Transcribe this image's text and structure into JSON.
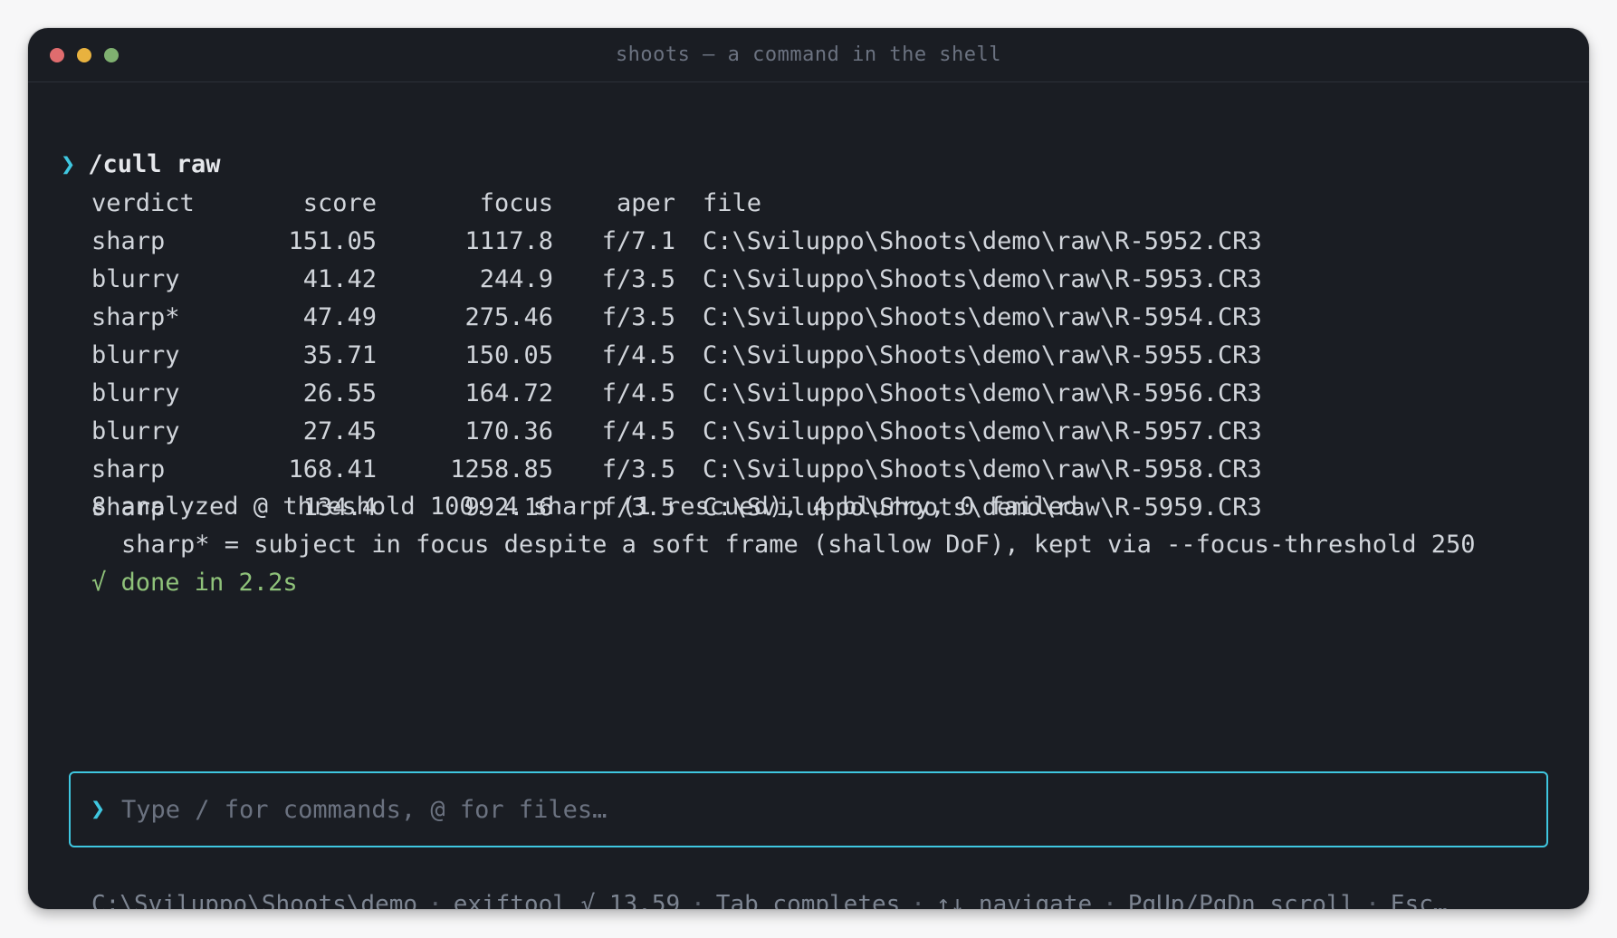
{
  "window": {
    "title": "shoots — a command in the shell"
  },
  "command": {
    "prompt": "❯",
    "text": "/cull raw"
  },
  "table": {
    "headers": {
      "verdict": "verdict",
      "score": "score",
      "focus": "focus",
      "aper": "aper",
      "file": "file"
    },
    "rows": [
      {
        "verdict": "sharp",
        "score": "151.05",
        "focus": "1117.8",
        "aper": "f/7.1",
        "file": "C:\\Sviluppo\\Shoots\\demo\\raw\\R-5952.CR3"
      },
      {
        "verdict": "blurry",
        "score": "41.42",
        "focus": "244.9",
        "aper": "f/3.5",
        "file": "C:\\Sviluppo\\Shoots\\demo\\raw\\R-5953.CR3"
      },
      {
        "verdict": "sharp*",
        "score": "47.49",
        "focus": "275.46",
        "aper": "f/3.5",
        "file": "C:\\Sviluppo\\Shoots\\demo\\raw\\R-5954.CR3"
      },
      {
        "verdict": "blurry",
        "score": "35.71",
        "focus": "150.05",
        "aper": "f/4.5",
        "file": "C:\\Sviluppo\\Shoots\\demo\\raw\\R-5955.CR3"
      },
      {
        "verdict": "blurry",
        "score": "26.55",
        "focus": "164.72",
        "aper": "f/4.5",
        "file": "C:\\Sviluppo\\Shoots\\demo\\raw\\R-5956.CR3"
      },
      {
        "verdict": "blurry",
        "score": "27.45",
        "focus": "170.36",
        "aper": "f/4.5",
        "file": "C:\\Sviluppo\\Shoots\\demo\\raw\\R-5957.CR3"
      },
      {
        "verdict": "sharp",
        "score": "168.41",
        "focus": "1258.85",
        "aper": "f/3.5",
        "file": "C:\\Sviluppo\\Shoots\\demo\\raw\\R-5958.CR3"
      },
      {
        "verdict": "sharp",
        "score": "134.4",
        "focus": "992.16",
        "aper": "f/3.5",
        "file": "C:\\Sviluppo\\Shoots\\demo\\raw\\R-5959.CR3"
      }
    ]
  },
  "summary": "8 analyzed @ threshold 100: 4 sharp (1 rescued), 4 blurry, 0 failed",
  "note": "sharp* = subject in focus despite a soft frame (shallow DoF), kept via --focus-threshold 250",
  "done": "√ done in 2.2s",
  "input": {
    "prompt": "❯",
    "placeholder": "Type / for commands, @ for files…",
    "value": ""
  },
  "statusbar": {
    "separator": "·",
    "items": [
      "C:\\Sviluppo\\Shoots\\demo",
      "exiftool √ 13.59",
      "Tab completes",
      "↑↓ navigate",
      "PgUp/PgDn scroll",
      "Esc…"
    ]
  },
  "colors": {
    "background": "#1a1d23",
    "accent": "#3fc7e0",
    "success": "#8fc27a",
    "text": "#d1d5db",
    "muted": "#6b7280"
  }
}
